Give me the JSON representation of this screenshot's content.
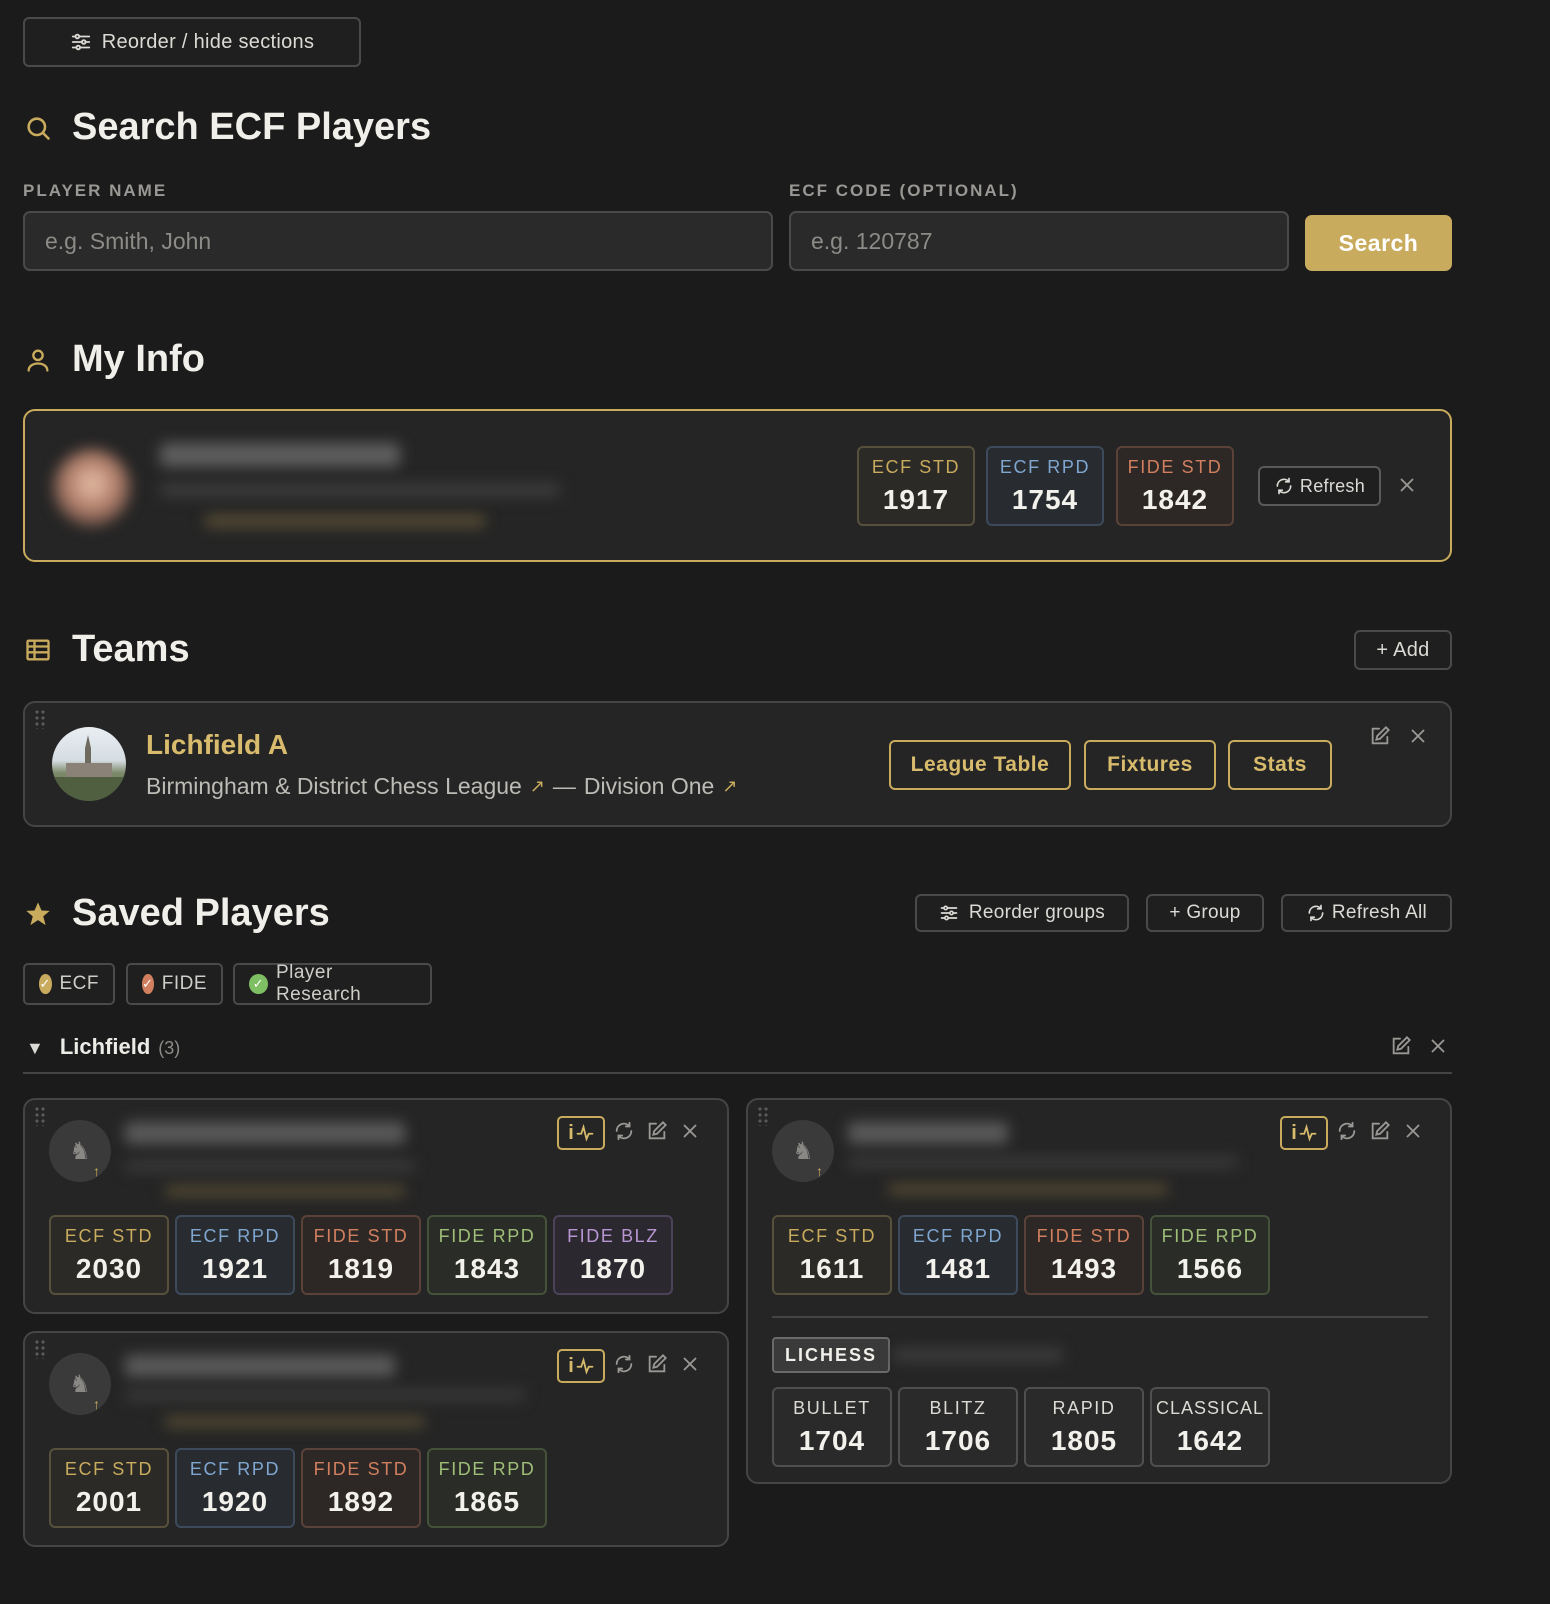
{
  "toolbar": {
    "reorder_label": "Reorder / hide sections"
  },
  "search": {
    "title": "Search ECF Players",
    "name_label": "PLAYER NAME",
    "name_placeholder": "e.g. Smith, John",
    "code_label": "ECF CODE (OPTIONAL)",
    "code_placeholder": "e.g. 120787",
    "button": "Search"
  },
  "my_info": {
    "title": "My Info",
    "ratings": [
      {
        "label": "ECF STD",
        "value": "1917"
      },
      {
        "label": "ECF RPD",
        "value": "1754"
      },
      {
        "label": "FIDE STD",
        "value": "1842"
      }
    ],
    "refresh_label": "Refresh"
  },
  "teams": {
    "title": "Teams",
    "add_label": "+ Add",
    "items": [
      {
        "name": "Lichfield A",
        "league": "Birmingham & District Chess League",
        "separator": "—",
        "division": "Division One",
        "buttons": [
          "League Table",
          "Fixtures",
          "Stats"
        ]
      }
    ]
  },
  "saved": {
    "title": "Saved Players",
    "reorder_groups": "Reorder groups",
    "add_group": "+ Group",
    "refresh_all": "Refresh All",
    "filters": [
      {
        "label": "ECF",
        "color": "#c9ab5e"
      },
      {
        "label": "FIDE",
        "color": "#d17f5e"
      },
      {
        "label": "Player Research",
        "color": "#7fbf63"
      }
    ],
    "group": {
      "name": "Lichfield",
      "count": "(3)",
      "toggle": "▼"
    },
    "players": [
      {
        "ratings": [
          {
            "label": "ECF STD",
            "value": "2030",
            "kind": "ecf-std"
          },
          {
            "label": "ECF RPD",
            "value": "1921",
            "kind": "ecf-rpd"
          },
          {
            "label": "FIDE STD",
            "value": "1819",
            "kind": "fide-std"
          },
          {
            "label": "FIDE RPD",
            "value": "1843",
            "kind": "fide-rpd"
          },
          {
            "label": "FIDE BLZ",
            "value": "1870",
            "kind": "fide-blz"
          }
        ]
      },
      {
        "ratings": [
          {
            "label": "ECF STD",
            "value": "2001",
            "kind": "ecf-std"
          },
          {
            "label": "ECF RPD",
            "value": "1920",
            "kind": "ecf-rpd"
          },
          {
            "label": "FIDE STD",
            "value": "1892",
            "kind": "fide-std"
          },
          {
            "label": "FIDE RPD",
            "value": "1865",
            "kind": "fide-rpd"
          }
        ]
      },
      {
        "ratings": [
          {
            "label": "ECF STD",
            "value": "1611",
            "kind": "ecf-std"
          },
          {
            "label": "ECF RPD",
            "value": "1481",
            "kind": "ecf-rpd"
          },
          {
            "label": "FIDE STD",
            "value": "1493",
            "kind": "fide-std"
          },
          {
            "label": "FIDE RPD",
            "value": "1566",
            "kind": "fide-rpd"
          }
        ],
        "lichess_tag": "LICHESS",
        "lichess": [
          {
            "label": "BULLET",
            "value": "1704"
          },
          {
            "label": "BLITZ",
            "value": "1706"
          },
          {
            "label": "RAPID",
            "value": "1805"
          },
          {
            "label": "CLASSICAL",
            "value": "1642"
          }
        ]
      }
    ]
  },
  "icons": [
    "sliders-icon",
    "search-icon",
    "user-icon",
    "table-icon",
    "star-icon",
    "refresh-icon",
    "close-icon",
    "edit-icon",
    "external-link-icon",
    "activity-icon",
    "chess-knight-icon",
    "grip-icon",
    "check-icon"
  ],
  "colors": {
    "accent": "#c9ab5e",
    "background": "#1b1b1b",
    "card": "#252525"
  }
}
